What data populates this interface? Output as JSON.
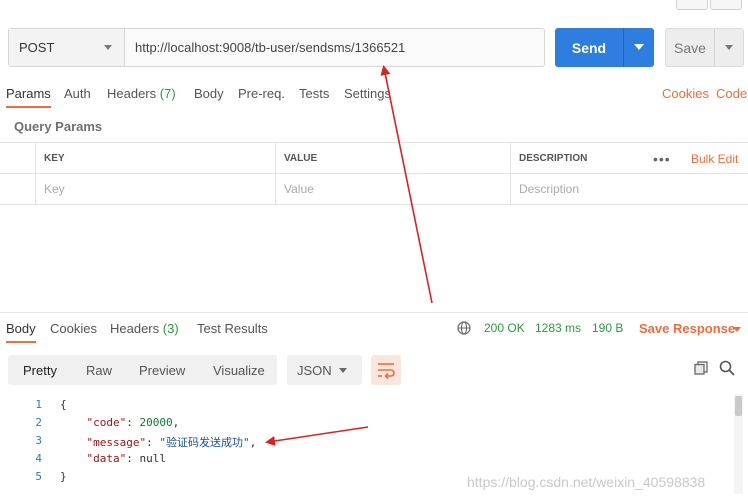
{
  "request": {
    "method": "POST",
    "url": "http://localhost:9008/tb-user/sendsms/1366521",
    "send_label": "Send",
    "save_label": "Save"
  },
  "request_tabs": {
    "params": "Params",
    "auth": "Auth",
    "headers": "Headers",
    "headers_count": "(7)",
    "body": "Body",
    "prereq": "Pre-req.",
    "tests": "Tests",
    "settings": "Settings",
    "cookies": "Cookies",
    "code": "Code"
  },
  "query_params": {
    "title": "Query Params",
    "columns": {
      "key": "KEY",
      "value": "VALUE",
      "description": "DESCRIPTION"
    },
    "more": "•••",
    "bulk_edit": "Bulk Edit",
    "placeholders": {
      "key": "Key",
      "value": "Value",
      "description": "Description"
    }
  },
  "response_tabs": {
    "body": "Body",
    "cookies": "Cookies",
    "headers": "Headers",
    "headers_count": "(3)",
    "test_results": "Test Results"
  },
  "response_status": {
    "status": "200 OK",
    "time": "1283 ms",
    "size": "190 B",
    "save_response": "Save Response"
  },
  "view_modes": {
    "pretty": "Pretty",
    "raw": "Raw",
    "preview": "Preview",
    "visualize": "Visualize",
    "format": "JSON"
  },
  "code": {
    "line_numbers": [
      "1",
      "2",
      "3",
      "4",
      "5"
    ],
    "open_brace": "{",
    "close_brace": "}",
    "code_key": "\"code\"",
    "code_value": "20000",
    "message_key": "\"message\"",
    "message_value": "\"验证码发送成功\"",
    "data_key": "\"data\"",
    "data_value": "null"
  },
  "watermark": "https://blog.csdn.net/weixin_40598838",
  "colors": {
    "accent": "#f26b3a",
    "send": "#2e7ee0",
    "success": "#2e9b3b",
    "annotation_arrow": "#e02020"
  }
}
